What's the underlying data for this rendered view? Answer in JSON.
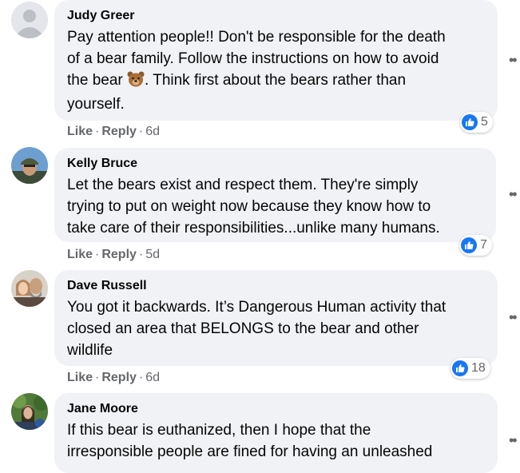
{
  "comments": [
    {
      "author": "Judy Greer",
      "lines": [
        "Pay attention people!! Don't be responsible for the death",
        "of a bear family. Follow the instructions on how to avoid"
      ],
      "line3_before": "the bear ",
      "line3_emoji": "bear-face-icon",
      "line3_after": ". Think first about the bears rather than",
      "line4": "yourself.",
      "like": "Like",
      "reply": "Reply",
      "time": "6d",
      "reactions": "5"
    },
    {
      "author": "Kelly Bruce",
      "lines": [
        "Let the bears exist and respect them. They're simply",
        "trying to put on weight now because they know how to",
        "take care of their responsibilities...unlike many humans."
      ],
      "like": "Like",
      "reply": "Reply",
      "time": "5d",
      "reactions": "7"
    },
    {
      "author": "Dave Russell",
      "lines": [
        "You got it backwards. It’s Dangerous Human activity that",
        "closed an area that BELONGS to the bear and other",
        "wildlife"
      ],
      "like": "Like",
      "reply": "Reply",
      "time": "6d",
      "reactions": "18"
    },
    {
      "author": "Jane Moore",
      "lines": [
        "If this bear is euthanized, then I hope that the",
        "irresponsible people are fined for having an unleashed"
      ]
    }
  ],
  "separator": "·",
  "more_icon": "more-options-icon",
  "like_icon": "thumbs-up-icon",
  "colors": {
    "bubble": "#f0f2f5",
    "meta": "#65676b",
    "like_blue": "#1877f2"
  }
}
